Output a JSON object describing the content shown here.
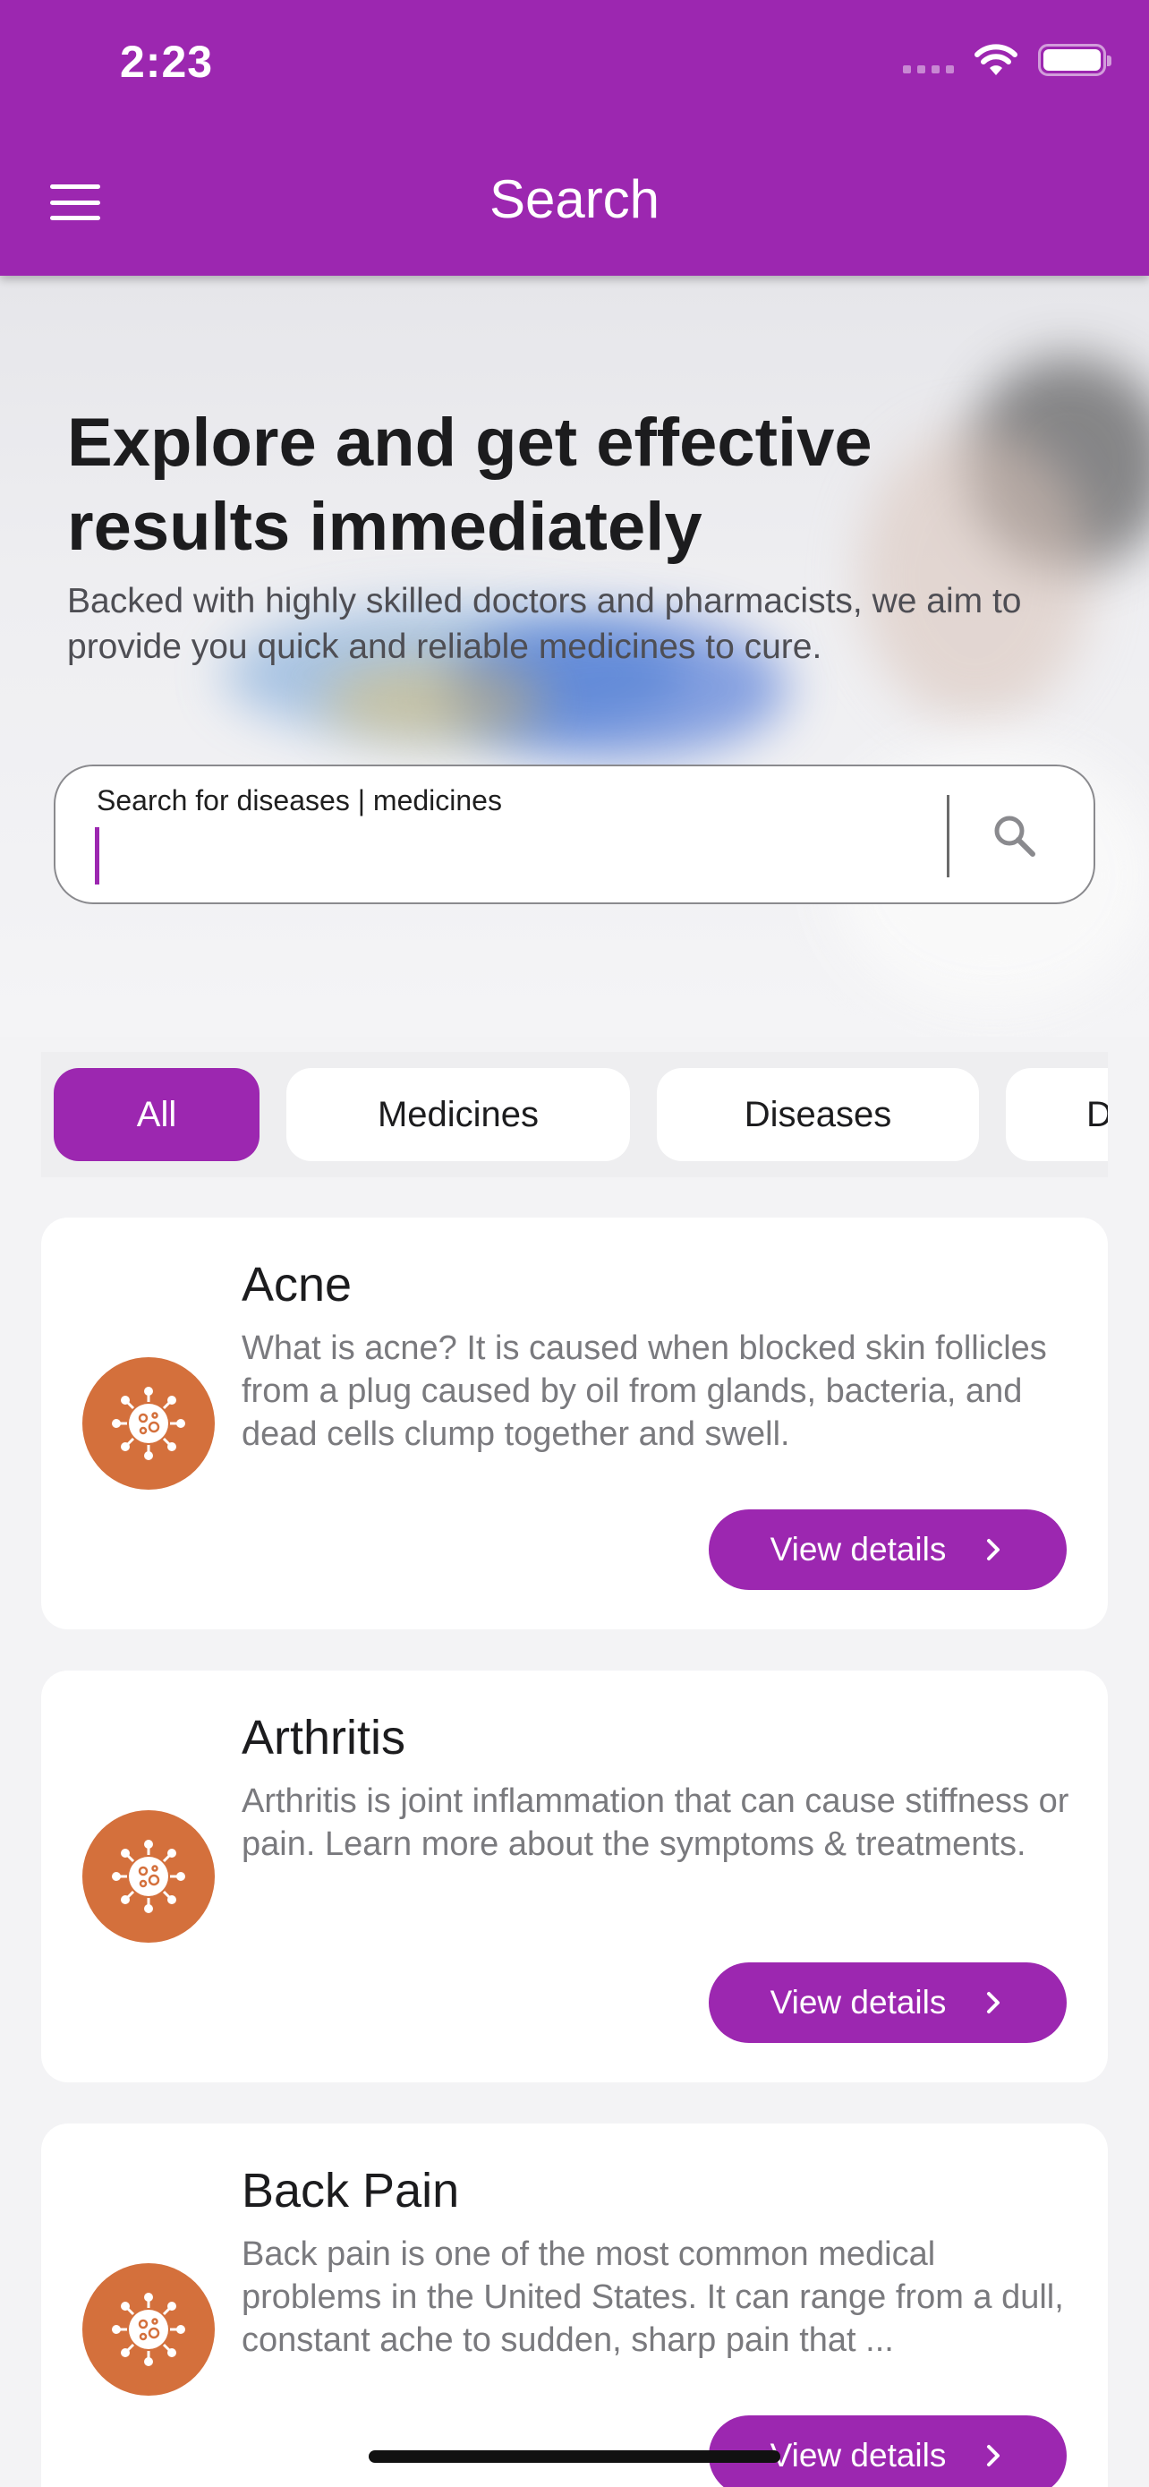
{
  "status_bar": {
    "time": "2:23",
    "icons": [
      "signal-icon",
      "wifi-icon",
      "battery-icon"
    ]
  },
  "header": {
    "title": "Search",
    "menu_icon": "hamburger-menu-icon"
  },
  "hero": {
    "title": "Explore and get effective results immediately",
    "subtitle": "Backed with highly skilled doctors and pharmacists, we aim to provide you quick and reliable medicines to cure.",
    "search": {
      "placeholder": "Search for diseases | medicines",
      "value": "",
      "icon": "search-icon"
    }
  },
  "filters": [
    {
      "label": "All",
      "active": true
    },
    {
      "label": "Medicines",
      "active": false
    },
    {
      "label": "Diseases",
      "active": false
    },
    {
      "label": "D",
      "active": false
    }
  ],
  "results": [
    {
      "title": "Acne",
      "description": "What is acne? It is caused when blocked skin follicles from a plug caused by oil from glands, bacteria, and dead cells clump together and swell.",
      "button": "View details",
      "icon": "virus-icon"
    },
    {
      "title": "Arthritis",
      "description": "Arthritis is joint inflammation that can cause stiffness or pain. Learn more about the symptoms & treatments.",
      "button": "View details",
      "icon": "virus-icon"
    },
    {
      "title": "Back Pain",
      "description": "Back pain is one of the most common medical problems in the United States. It can range from a dull, constant ache to sudden, sharp pain that ...",
      "button": "View details",
      "icon": "virus-icon"
    }
  ],
  "colors": {
    "primary": "#9c27b0",
    "icon_bg": "#d4703c",
    "background": "#f3f3f5"
  }
}
